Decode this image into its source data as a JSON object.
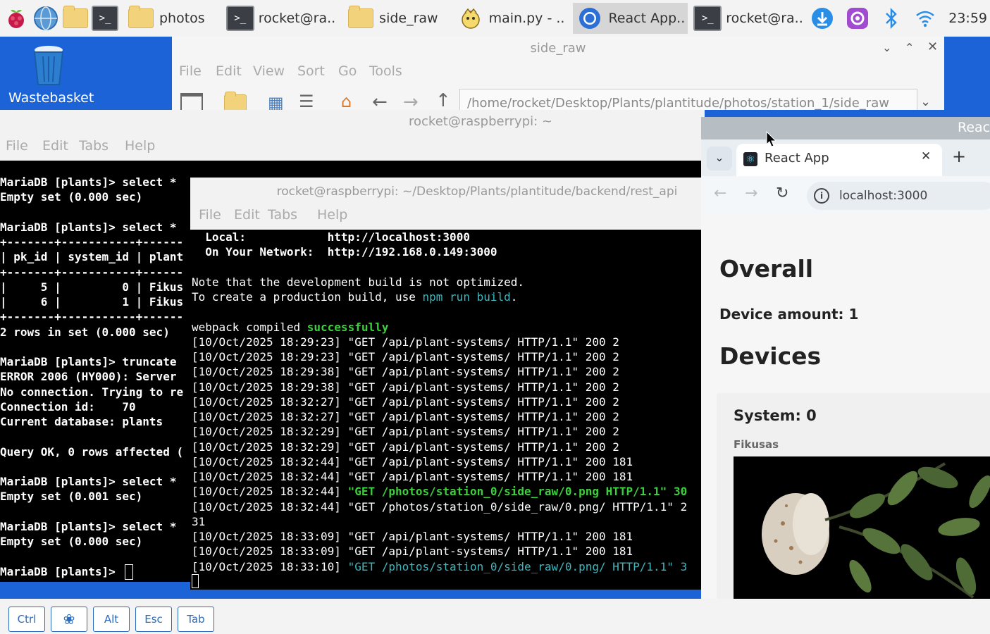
{
  "taskbar": {
    "tasks": [
      {
        "label": "photos"
      },
      {
        "label": "rocket@ra.."
      },
      {
        "label": "side_raw"
      },
      {
        "label": "main.py - .."
      },
      {
        "label": "React App.."
      },
      {
        "label": "rocket@ra.."
      }
    ],
    "clock": "23:59"
  },
  "desktop": {
    "trash_label": "Wastebasket"
  },
  "file_manager": {
    "title": "side_raw",
    "menu": [
      "File",
      "Edit",
      "View",
      "Sort",
      "Go",
      "Tools"
    ],
    "path": "/home/rocket/Desktop/Plants/plantitude/photos/station_1/side_raw"
  },
  "terminal1": {
    "title": "rocket@raspberrypi: ~",
    "menu": [
      "File",
      "Edit",
      "Tabs",
      "Help"
    ],
    "lines": [
      "MariaDB [plants]> select *",
      "Empty set (0.000 sec)",
      "",
      "MariaDB [plants]> select *",
      "+-------+-----------+------",
      "| pk_id | system_id | plant",
      "+-------+-----------+------",
      "|     5 |         0 | Fikus",
      "|     6 |         1 | Fikus",
      "+-------+-----------+------",
      "2 rows in set (0.000 sec)",
      "",
      "MariaDB [plants]> truncate",
      "ERROR 2006 (HY000): Server",
      "No connection. Trying to re",
      "Connection id:    70",
      "Current database: plants",
      "",
      "Query OK, 0 rows affected (",
      "",
      "MariaDB [plants]> select *",
      "Empty set (0.001 sec)",
      "",
      "MariaDB [plants]> select *",
      "Empty set (0.000 sec)",
      "",
      "MariaDB [plants]> "
    ]
  },
  "terminal2": {
    "title": "rocket@raspberrypi: ~/Desktop/Plants/plantitude/backend/rest_api",
    "menu": [
      "File",
      "Edit",
      "Tabs",
      "Help"
    ],
    "local_label": "  Local:            http://localhost:",
    "local_port": "3000",
    "network_label": "  On Your Network:  http://192.168.0.149:",
    "network_port": "3000",
    "note1": "Note that the development build is not optimized.",
    "note2_a": "To create a production build, use ",
    "note2_b": "npm run build",
    "note2_c": ".",
    "compiled_a": "webpack compiled ",
    "compiled_b": "successfully",
    "log": [
      {
        "text": "[10/Oct/2025 18:29:23] \"GET /api/plant-systems/ HTTP/1.1\" 200 2",
        "style": ""
      },
      {
        "text": "[10/Oct/2025 18:29:23] \"GET /api/plant-systems/ HTTP/1.1\" 200 2",
        "style": ""
      },
      {
        "text": "[10/Oct/2025 18:29:38] \"GET /api/plant-systems/ HTTP/1.1\" 200 2",
        "style": ""
      },
      {
        "text": "[10/Oct/2025 18:29:38] \"GET /api/plant-systems/ HTTP/1.1\" 200 2",
        "style": ""
      },
      {
        "text": "[10/Oct/2025 18:32:27] \"GET /api/plant-systems/ HTTP/1.1\" 200 2",
        "style": ""
      },
      {
        "text": "[10/Oct/2025 18:32:27] \"GET /api/plant-systems/ HTTP/1.1\" 200 2",
        "style": ""
      },
      {
        "text": "[10/Oct/2025 18:32:29] \"GET /api/plant-systems/ HTTP/1.1\" 200 2",
        "style": ""
      },
      {
        "text": "[10/Oct/2025 18:32:29] \"GET /api/plant-systems/ HTTP/1.1\" 200 2",
        "style": ""
      },
      {
        "text": "[10/Oct/2025 18:32:44] \"GET /api/plant-systems/ HTTP/1.1\" 200 181",
        "style": ""
      },
      {
        "text": "[10/Oct/2025 18:32:44] \"GET /api/plant-systems/ HTTP/1.1\" 200 181",
        "style": ""
      },
      {
        "text": "[10/Oct/2025 18:32:44] ",
        "green": "\"GET /photos/station_0/side_raw/0.png HTTP/1.1\" 30",
        "style": "g"
      },
      {
        "text": "[10/Oct/2025 18:32:44] \"GET /photos/station_0/side_raw/0.png/ HTTP/1.1\" 2",
        "style": ""
      },
      {
        "text": "31",
        "style": ""
      },
      {
        "text": "[10/Oct/2025 18:33:09] \"GET /api/plant-systems/ HTTP/1.1\" 200 181",
        "style": ""
      },
      {
        "text": "[10/Oct/2025 18:33:09] \"GET /api/plant-systems/ HTTP/1.1\" 200 181",
        "style": ""
      },
      {
        "text": "[10/Oct/2025 18:33:10] ",
        "green": "\"GET /photos/station_0/side_raw/0.png/ HTTP/1.1\" 3",
        "style": "c"
      }
    ]
  },
  "browser": {
    "window_title": "Reac",
    "tab_label": "React App",
    "url": "localhost:3000",
    "page": {
      "overall_heading": "Overall",
      "device_amount": "Device amount: 1",
      "devices_heading": "Devices",
      "system_label": "System: 0",
      "plant_name": "Fikusas"
    }
  },
  "bottom_keys": [
    "Ctrl",
    "Alt",
    "Esc",
    "Tab"
  ]
}
